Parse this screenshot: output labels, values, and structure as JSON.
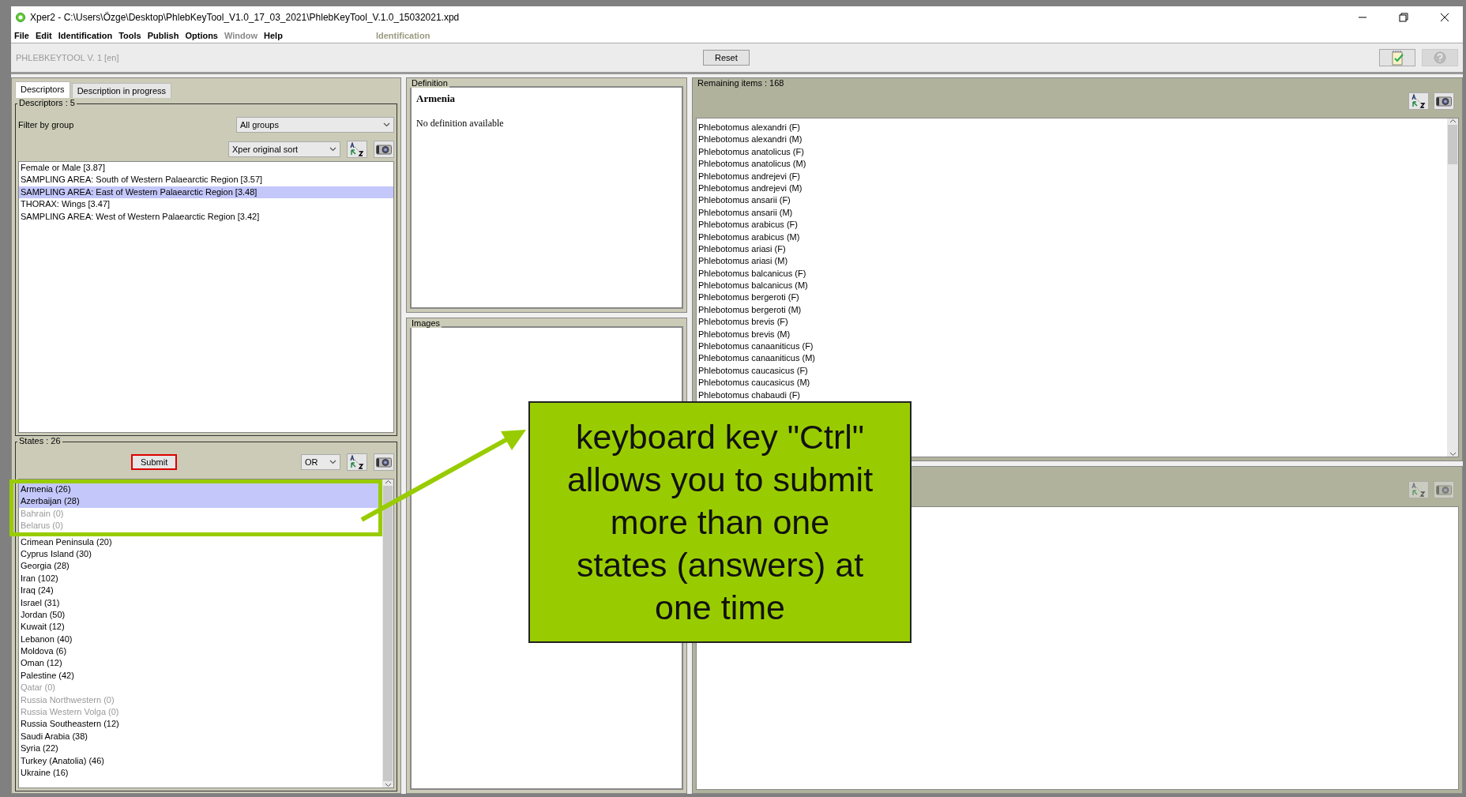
{
  "window": {
    "title": "Xper2 - C:\\Users\\Özge\\Desktop\\PhlebKeyTool_V1.0_17_03_2021\\PhlebKeyTool_V.1.0_15032021.xpd",
    "menu": [
      {
        "label": "File",
        "disabled": false
      },
      {
        "label": "Edit",
        "disabled": false
      },
      {
        "label": "Identification",
        "disabled": false
      },
      {
        "label": "Tools",
        "disabled": false
      },
      {
        "label": "Publish",
        "disabled": false
      },
      {
        "label": "Options",
        "disabled": false
      },
      {
        "label": "Window",
        "disabled": true
      },
      {
        "label": "Help",
        "disabled": false
      }
    ],
    "mode": "Identification"
  },
  "toolbar": {
    "project": "PHLEBKEYTOOL V. 1 [en]",
    "reset": "Reset"
  },
  "tabs": [
    {
      "label": "Descriptors",
      "selected": true
    },
    {
      "label": "Description in progress",
      "selected": false
    }
  ],
  "descriptors": {
    "title": "Descriptors : 5",
    "filter_label": "Filter by group",
    "group": "All groups",
    "sort": "Xper original sort",
    "items": [
      {
        "label": "Female or Male [3.87]",
        "selected": false
      },
      {
        "label": "SAMPLING AREA: South of Western Palaearctic Region [3.57]",
        "selected": false
      },
      {
        "label": "SAMPLING AREA: East of Western Palaearctic Region  [3.48]",
        "selected": true
      },
      {
        "label": "THORAX: Wings [3.47]",
        "selected": false
      },
      {
        "label": "SAMPLING AREA: West of Western Palaearctic Region [3.42]",
        "selected": false
      }
    ]
  },
  "states": {
    "title": "States : 26",
    "submit": "Submit",
    "operator": "OR",
    "items": [
      {
        "label": "Armenia (26)",
        "selected": true,
        "disabled": false,
        "highlighted": true
      },
      {
        "label": "Azerbaijan (28)",
        "selected": true,
        "disabled": false,
        "highlighted": true
      },
      {
        "label": "Bahrain (0)",
        "selected": false,
        "disabled": true,
        "highlighted": true
      },
      {
        "label": "Belarus (0)",
        "selected": false,
        "disabled": true,
        "highlighted": true
      },
      {
        "label": "Crimean Peninsula (20)",
        "selected": false,
        "disabled": false
      },
      {
        "label": "Cyprus Island (30)",
        "selected": false,
        "disabled": false
      },
      {
        "label": "Georgia (28)",
        "selected": false,
        "disabled": false
      },
      {
        "label": "Iran (102)",
        "selected": false,
        "disabled": false
      },
      {
        "label": "Iraq (24)",
        "selected": false,
        "disabled": false
      },
      {
        "label": "Israel (31)",
        "selected": false,
        "disabled": false
      },
      {
        "label": "Jordan (50)",
        "selected": false,
        "disabled": false
      },
      {
        "label": "Kuwait (12)",
        "selected": false,
        "disabled": false
      },
      {
        "label": "Lebanon (40)",
        "selected": false,
        "disabled": false
      },
      {
        "label": "Moldova (6)",
        "selected": false,
        "disabled": false
      },
      {
        "label": "Oman (12)",
        "selected": false,
        "disabled": false
      },
      {
        "label": "Palestine (42)",
        "selected": false,
        "disabled": false
      },
      {
        "label": "Qatar (0)",
        "selected": false,
        "disabled": true
      },
      {
        "label": "Russia Northwestern (0)",
        "selected": false,
        "disabled": true
      },
      {
        "label": "Russia Western Volga (0)",
        "selected": false,
        "disabled": true
      },
      {
        "label": "Russia Southeastern (12)",
        "selected": false,
        "disabled": false
      },
      {
        "label": "Saudi Arabia (38)",
        "selected": false,
        "disabled": false
      },
      {
        "label": "Syria (22)",
        "selected": false,
        "disabled": false
      },
      {
        "label": "Turkey (Anatolia) (46)",
        "selected": false,
        "disabled": false
      },
      {
        "label": "Ukraine (16)",
        "selected": false,
        "disabled": false
      }
    ]
  },
  "definition": {
    "title": "Definition",
    "heading": "Armenia",
    "text": "No definition available"
  },
  "images": {
    "title": "Images"
  },
  "remaining": {
    "title": "Remaining items : 168",
    "items": [
      "Phlebotomus alexandri (F)",
      "Phlebotomus alexandri (M)",
      "Phlebotomus anatolicus (F)",
      "Phlebotomus anatolicus (M)",
      "Phlebotomus andrejevi (F)",
      "Phlebotomus andrejevi (M)",
      "Phlebotomus ansarii (F)",
      "Phlebotomus ansarii (M)",
      "Phlebotomus arabicus (F)",
      "Phlebotomus arabicus (M)",
      "Phlebotomus ariasi (F)",
      "Phlebotomus ariasi (M)",
      "Phlebotomus balcanicus (F)",
      "Phlebotomus balcanicus (M)",
      "Phlebotomus bergeroti (F)",
      "Phlebotomus bergeroti (M)",
      "Phlebotomus brevis (F)",
      "Phlebotomus brevis (M)",
      "Phlebotomus canaaniticus (F)",
      "Phlebotomus canaaniticus (M)",
      "Phlebotomus caucasicus (F)",
      "Phlebotomus caucasicus (M)",
      "Phlebotomus chabaudi (F)"
    ]
  },
  "callout": {
    "text": "keyboard key \"Ctrl\" allows you to submit more than one states (answers) at one time"
  }
}
